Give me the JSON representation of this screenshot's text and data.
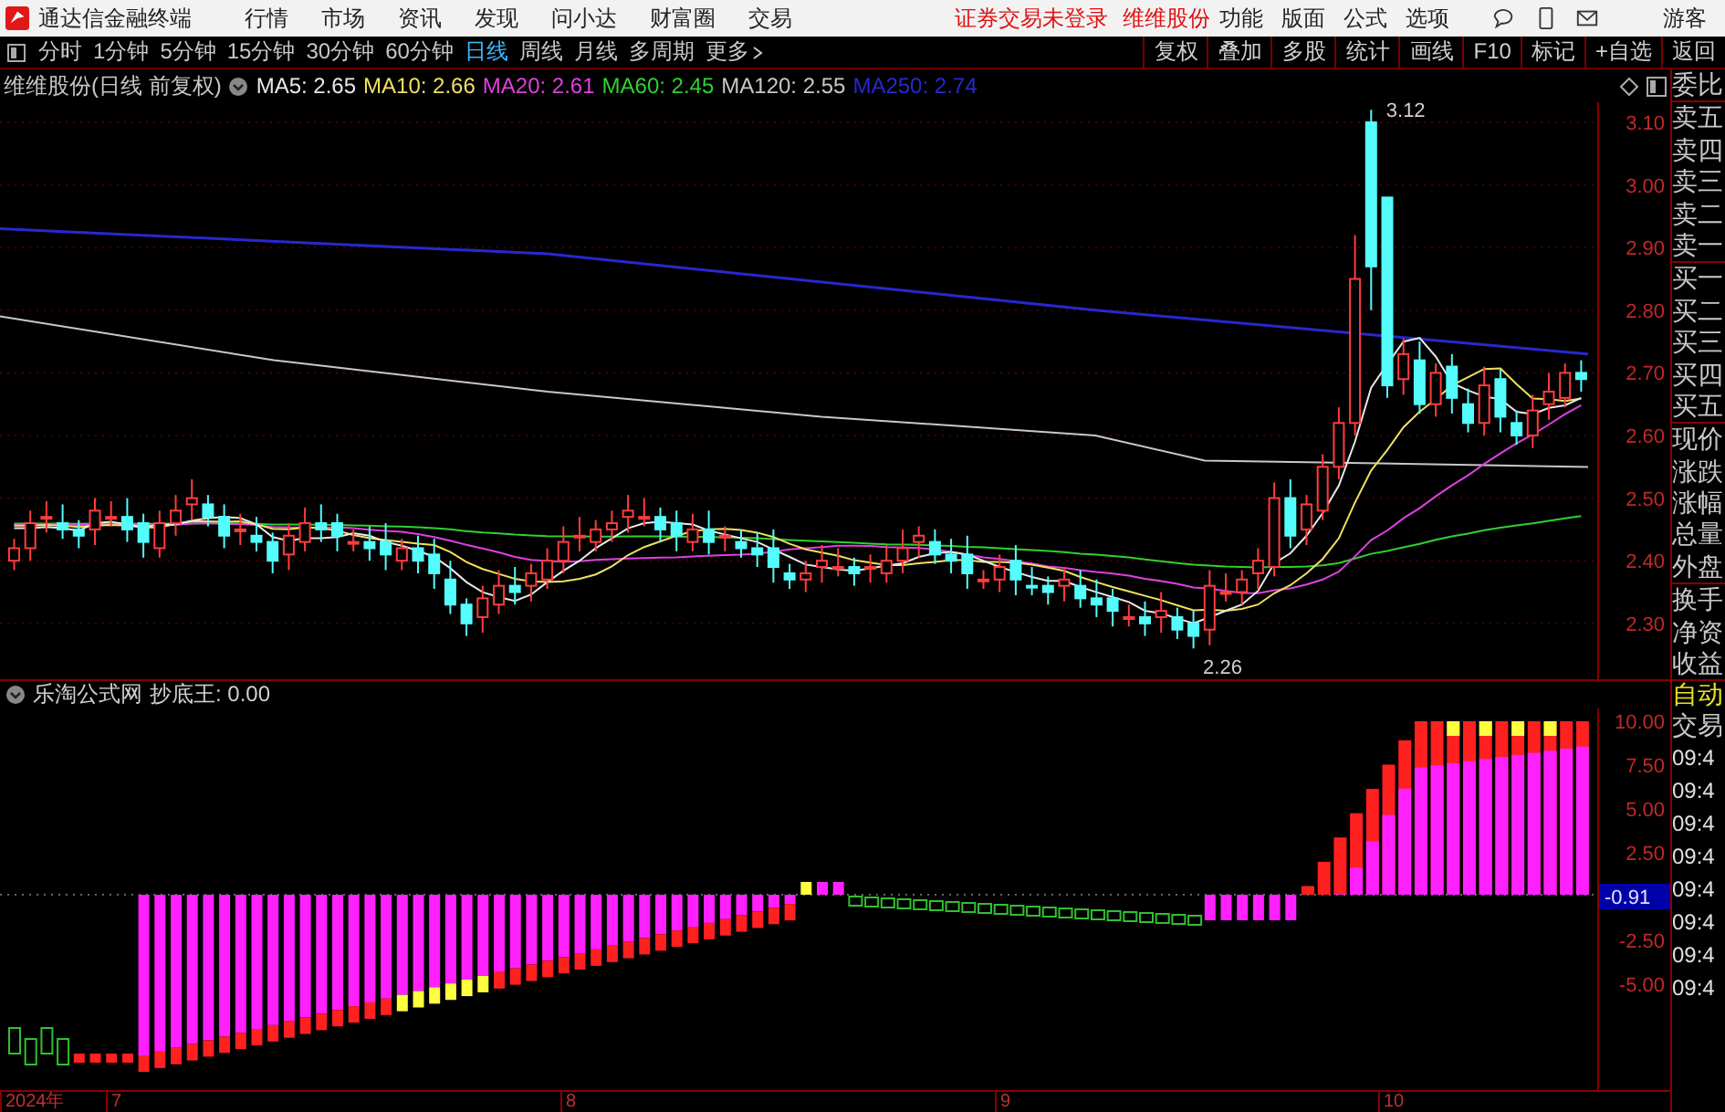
{
  "app": {
    "title": "通达信金融终端",
    "menu": [
      "行情",
      "市场",
      "资讯",
      "发现",
      "问小达",
      "财富圈",
      "交易"
    ],
    "notice": "证券交易未登录",
    "stock_link": "维维股份",
    "tools": [
      "功能",
      "版面",
      "公式",
      "选项"
    ],
    "user": "游客"
  },
  "periods": [
    {
      "label": "分时",
      "selected": false
    },
    {
      "label": "1分钟",
      "selected": false
    },
    {
      "label": "5分钟",
      "selected": false
    },
    {
      "label": "15分钟",
      "selected": false
    },
    {
      "label": "30分钟",
      "selected": false
    },
    {
      "label": "60分钟",
      "selected": false
    },
    {
      "label": "日线",
      "selected": true
    },
    {
      "label": "周线",
      "selected": false
    },
    {
      "label": "月线",
      "selected": false
    },
    {
      "label": "多周期",
      "selected": false
    },
    {
      "label": "更多",
      "selected": false
    }
  ],
  "actions": [
    "复权",
    "叠加",
    "多股",
    "统计",
    "画线",
    "F10",
    "标记",
    "+自选",
    "返回"
  ],
  "chart": {
    "title": "维维股份(日线 前复权)",
    "mas": [
      {
        "label": "MA5: 2.65",
        "color": "#e8e8e8"
      },
      {
        "label": "MA10: 2.66",
        "color": "#f0e060"
      },
      {
        "label": "MA20: 2.61",
        "color": "#e040e0"
      },
      {
        "label": "MA60: 2.45",
        "color": "#30d030"
      },
      {
        "label": "MA120: 2.55",
        "color": "#c8c8c8"
      },
      {
        "label": "MA250: 2.74",
        "color": "#2828d0"
      }
    ],
    "price_ticks": [
      "3.10",
      "3.00",
      "2.90",
      "2.80",
      "2.70",
      "2.60",
      "2.50",
      "2.40",
      "2.30"
    ],
    "high_label": "3.12",
    "low_label": "2.26"
  },
  "indicator": {
    "title": "乐淘公式网",
    "formula": "抄底王: 0.00",
    "ticks": [
      {
        "label": "10.00",
        "kind": "tick"
      },
      {
        "label": "7.50",
        "kind": "tick"
      },
      {
        "label": "5.00",
        "kind": "tick"
      },
      {
        "label": "2.50",
        "kind": "tick"
      },
      {
        "label": "-0.91",
        "kind": "current"
      },
      {
        "label": "-2.50",
        "kind": "tick"
      },
      {
        "label": "-5.00",
        "kind": "tick"
      }
    ]
  },
  "x_axis": [
    "2024年",
    "7",
    "8",
    "9",
    "10"
  ],
  "quote_panel": {
    "groups": [
      [
        "委比"
      ],
      [
        "卖五",
        "卖四",
        "卖三",
        "卖二",
        "卖一"
      ],
      [
        "买一",
        "买二",
        "买三",
        "买四",
        "买五"
      ],
      [
        "现价",
        "涨跌",
        "涨幅",
        "总量",
        "外盘"
      ],
      [
        "换手",
        "净资",
        "收益"
      ]
    ],
    "mode": "自动",
    "trade": "交易",
    "times": [
      "09:4",
      "09:4",
      "09:4",
      "09:4",
      "09:4",
      "09:4",
      "09:4",
      "09:4"
    ]
  }
}
